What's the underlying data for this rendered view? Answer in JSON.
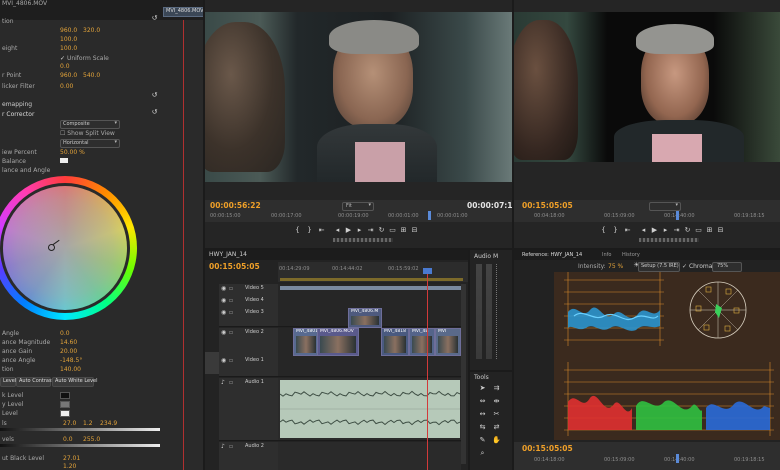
{
  "effect_controls": {
    "clip_tab": "MVI_4806.MOV",
    "rows": [
      {
        "label": "tion",
        "v1": "",
        "v2": ""
      },
      {
        "label": "",
        "v1": "960.0",
        "v2": "320.0"
      },
      {
        "label": "",
        "v1": "100.0",
        "v2": ""
      },
      {
        "label": "eight",
        "v1": "100.0",
        "v2": ""
      },
      {
        "label": "",
        "v1": "",
        "v2": ""
      },
      {
        "label": "",
        "v1": "0.0",
        "v2": ""
      },
      {
        "label": "r Point",
        "v1": "960.0",
        "v2": "540.0"
      },
      {
        "label": "licker Filter",
        "v1": "0.00",
        "v2": ""
      }
    ],
    "uniform_scale_label": "Uniform Scale",
    "remapping_label": "emapping",
    "color_corrector_label": "r Corrector",
    "output_dropdown": "Composite",
    "show_split_view_label": "Show Split View",
    "layout_dropdown": "Horizontal",
    "view_percent_label": "iew Percent",
    "view_percent_value": "50.00 %",
    "balance_label": "Balance",
    "balance_angle_label": "lance and Angle",
    "wheel_params": [
      {
        "label": "Angle",
        "value": "0.0"
      },
      {
        "label": "ance Magnitude",
        "value": "14.60"
      },
      {
        "label": "ance Gain",
        "value": "20.00"
      },
      {
        "label": "ance Angle",
        "value": "-148.5°"
      },
      {
        "label": "tion",
        "value": "140.00"
      }
    ],
    "level_buttons": [
      "Level",
      "Auto Contrast",
      "Auto White Level"
    ],
    "levels": [
      {
        "label": "k Level",
        "v1": "",
        "v2": "",
        "v3": ""
      },
      {
        "label": "y Level",
        "v1": "",
        "v2": "",
        "v3": ""
      },
      {
        "label": "Level",
        "v1": "",
        "v2": "",
        "v3": ""
      },
      {
        "label": "ls",
        "v1": "27.0",
        "v2": "1.2",
        "v3": "234.9"
      },
      {
        "label": "vels",
        "v1": "0.0",
        "v2": "255.0",
        "v3": ""
      },
      {
        "label": "ut Black Level",
        "v1": "27.01",
        "v2": "",
        "v3": ""
      },
      {
        "label": "",
        "v1": "1.20",
        "v2": "",
        "v3": ""
      }
    ]
  },
  "source_monitor": {
    "zoom": "Fit",
    "current_time": "00:00:56:22",
    "duration": "00:00:07:10",
    "ruler_ticks": [
      "00:00:15:00",
      "00:00:17:00",
      "00:00:19:00",
      "00:00:01:00",
      "00:00:01:00"
    ]
  },
  "program_monitor": {
    "current_time": "00:15:05:05",
    "duration": "",
    "ruler_ticks": [
      "00:04:18:00",
      "00:15:09:00",
      "00:14:40:00",
      "00:19:18:15"
    ]
  },
  "timeline": {
    "sequence_tab": "HWY_JAN_14",
    "current_time": "00:15:05:05",
    "ruler_ticks": [
      "00:14:29:09",
      "00:14:44:02",
      "00:15:59:02"
    ],
    "tracks": [
      {
        "name": "Video 5",
        "type": "video"
      },
      {
        "name": "Video 4",
        "type": "video"
      },
      {
        "name": "Video 3",
        "type": "video"
      },
      {
        "name": "Video 2",
        "type": "video"
      },
      {
        "name": "Video 1",
        "type": "video"
      },
      {
        "name": "Audio 1",
        "type": "audio"
      },
      {
        "name": "Audio 2",
        "type": "audio"
      }
    ],
    "clips": [
      {
        "label": "MVI_4806.M",
        "track": "Video 3"
      },
      {
        "label": "MVI_4801",
        "track": "Video 2"
      },
      {
        "label": "MVI_4806.MOV",
        "track": "Video 2"
      },
      {
        "label": "MVI_4818",
        "track": "Video 2"
      },
      {
        "label": "MVI_4B",
        "track": "Video 2"
      },
      {
        "label": "MVI",
        "track": "Video 2"
      }
    ]
  },
  "audio_meter": {
    "title": "Audio M"
  },
  "tools": {
    "title": "Tools"
  },
  "reference": {
    "tabs": [
      "Reference: HWY_JAN_14",
      "Info",
      "History"
    ],
    "intensity_label": "Intensity:",
    "intensity_value": "75 %",
    "setup_label": "Setup (7.5 IRE)",
    "chroma_label": "Chroma",
    "chroma_value": "75%",
    "current_time": "00:15:05:05",
    "ruler_ticks": [
      "00:14:18:00",
      "00:15:09:00",
      "00:14:40:00",
      "00:19:18:15"
    ]
  },
  "colors": {
    "accent": "#f0a028",
    "playhead": "#d23a3a",
    "clip_video": "#5a5a8c",
    "clip_audio": "#b4c8b8"
  }
}
